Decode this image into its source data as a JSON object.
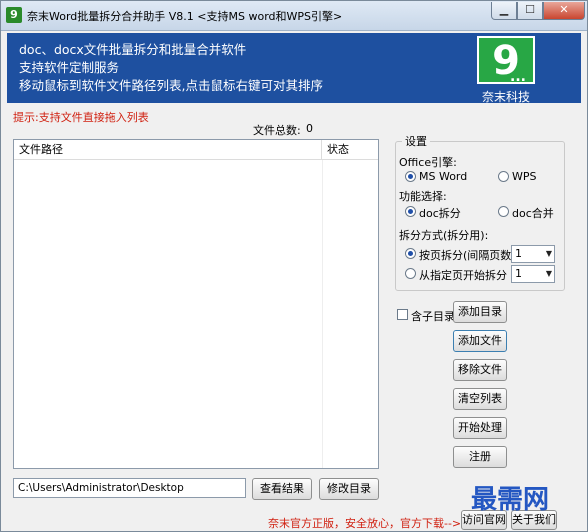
{
  "window": {
    "title": "奈末Word批量拆分合并助手 V8.1 <支持MS word和WPS引擎>",
    "icon_glyph": "9"
  },
  "banner": {
    "line1": "doc、docx文件批量拆分和批量合并软件",
    "line2": "支持软件定制服务",
    "line3": "移动鼠标到软件文件路径列表,点击鼠标右键可对其排序",
    "logo_glyph": "9",
    "logo_dots": "...",
    "brand": "奈末科技",
    "background_color": "#1e50a0",
    "logo_color": "#28a745"
  },
  "hint": "提示:支持文件直接拖入列表",
  "file_count": {
    "label": "文件总数:",
    "value": "0"
  },
  "file_list": {
    "columns": [
      "文件路径",
      "状态"
    ],
    "rows": []
  },
  "settings": {
    "title": "设置",
    "engine_label": "Office引擎:",
    "engine_options": [
      "MS Word",
      "WPS"
    ],
    "engine_selected": "MS Word",
    "function_label": "功能选择:",
    "function_options": [
      "doc拆分",
      "doc合并"
    ],
    "function_selected": "doc拆分",
    "split_label": "拆分方式(拆分用):",
    "split_options": [
      "按页拆分(间隔页数)",
      "从指定页开始拆分"
    ],
    "split_selected": "按页拆分(间隔页数)",
    "page_interval_value": "1",
    "start_page_value": "1"
  },
  "actions": {
    "include_subdir_label": "含子目录",
    "add_dir": "添加目录",
    "add_file": "添加文件",
    "remove_file": "移除文件",
    "clear_list": "清空列表",
    "start": "开始处理",
    "register": "注册"
  },
  "output": {
    "path": "C:\\Users\\Administrator\\Desktop",
    "view_result": "查看结果",
    "change_dir": "修改目录"
  },
  "footer": {
    "notice": "奈末官方正版，安全放心，官方下载-->>",
    "visit_site": "访问官网",
    "about": "关于我们"
  },
  "watermark": "最需网",
  "colors": {
    "accent": "#1e50a0",
    "hint": "#d02010"
  }
}
